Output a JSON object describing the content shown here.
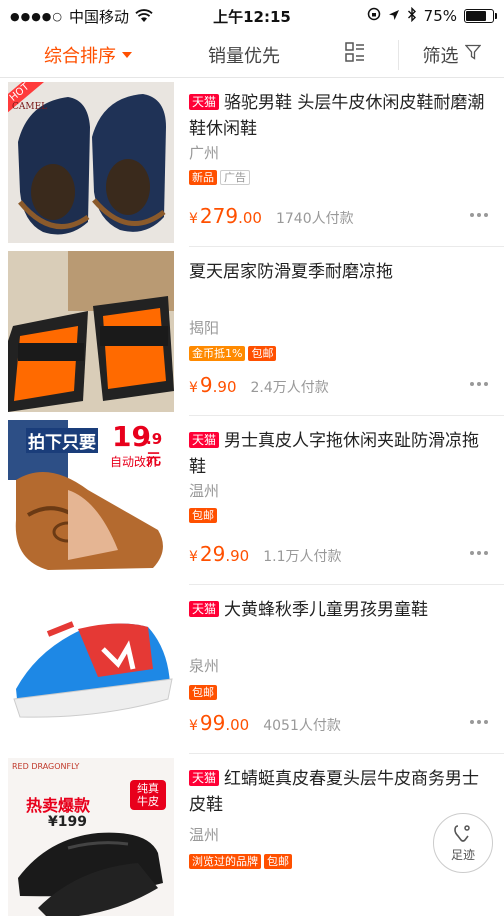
{
  "status": {
    "carrier": "中国移动",
    "time": "上午12:15",
    "battery": "75%",
    "battery_level": 0.75
  },
  "sort": {
    "tab1": "综合排序",
    "tab2": "销量优先",
    "tab4": "筛选"
  },
  "items": [
    {
      "tmall": "天猫",
      "title": "骆驼男鞋 头层牛皮休闲皮鞋耐磨潮鞋休闲鞋",
      "city": "广州",
      "tags": [
        "新品",
        "广告"
      ],
      "price_int": "279",
      "price_dec": ".00",
      "sales": "1740人付款",
      "thumb_badge": "HOT",
      "thumb_brand": "CAMEL"
    },
    {
      "tmall": "",
      "title": "夏天居家防滑夏季耐磨凉拖",
      "city": "揭阳",
      "tags": [
        "金币抵1%",
        "包邮"
      ],
      "price_int": "9",
      "price_dec": ".90",
      "sales": "2.4万人付款"
    },
    {
      "tmall": "天猫",
      "title": "男士真皮人字拖休闲夹趾防滑凉拖鞋",
      "city": "温州",
      "tags": [
        "包邮"
      ],
      "price_int": "29",
      "price_dec": ".90",
      "sales": "1.1万人付款",
      "promo_line1": "拍下只要",
      "promo_price": "19",
      "promo_sub": ".9元",
      "promo_line2": "自动改价"
    },
    {
      "tmall": "天猫",
      "title": "大黄蜂秋季儿童男孩男童鞋",
      "city": "泉州",
      "tags": [
        "包邮"
      ],
      "price_int": "99",
      "price_dec": ".00",
      "sales": "4051人付款"
    },
    {
      "tmall": "天猫",
      "title": "红蜻蜓真皮春夏头层牛皮商务男士皮鞋",
      "city": "温州",
      "tags": [
        "浏览过的品牌",
        "包邮"
      ],
      "thumb_brand": "RED DRAGONFLY",
      "promo_hot": "热卖爆款",
      "promo_tag": "纯真牛皮",
      "promo_price": "¥199"
    }
  ],
  "currency": "¥",
  "footprint": "足迹",
  "colors": {
    "accent": "#ff5000",
    "tmall": "#ff0036"
  }
}
